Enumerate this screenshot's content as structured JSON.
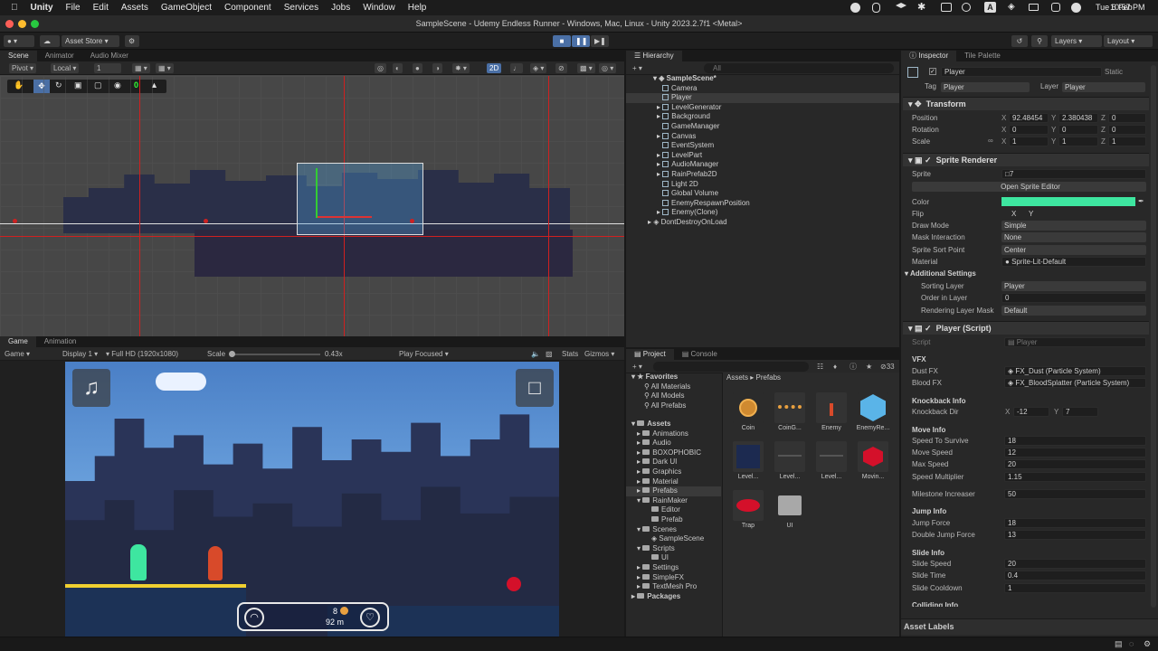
{
  "menubar": {
    "apple": "",
    "app": "Unity",
    "items": [
      "File",
      "Edit",
      "Assets",
      "GameObject",
      "Component",
      "Services",
      "Jobs",
      "Window",
      "Help"
    ],
    "date": "Tue 6 Feb",
    "time": "10:57 PM",
    "input": "A"
  },
  "window_title": "SampleScene - Udemy Endless Runner - Windows, Mac, Linux - Unity 2023.2.7f1 <Metal>",
  "toolbar": {
    "asset_store": "Asset Store",
    "layers": "Layers",
    "layout": "Layout"
  },
  "scene": {
    "tabs": [
      "Scene",
      "Animator",
      "Audio Mixer"
    ],
    "pivot": "Pivot",
    "local": "Local",
    "grid_value": "1",
    "mode_2d": "2D",
    "snap_count": "0"
  },
  "game": {
    "tabs": [
      "Game",
      "Animation"
    ],
    "view": "Game",
    "display": "Display 1",
    "resolution": "Full HD (1920x1080)",
    "scale_label": "Scale",
    "scale_value": "0.43x",
    "play_focused": "Play Focused",
    "stats": "Stats",
    "gizmos": "Gizmos",
    "coins": "8",
    "distance": "92  m"
  },
  "hierarchy": {
    "title": "Hierarchy",
    "search": "All",
    "scene": "SampleScene*",
    "items": [
      "Camera",
      "Player",
      "LevelGenerator",
      "Background",
      "GameManager",
      "Canvas",
      "EventSystem",
      "LevelPart",
      "AudioManager",
      "RainPrefab2D",
      "Light 2D",
      "Global Volume",
      "EnemyRespawnPosition",
      "Enemy(Clone)"
    ],
    "dont_destroy": "DontDestroyOnLoad"
  },
  "project": {
    "tabs": [
      "Project",
      "Console"
    ],
    "count": "33",
    "breadcrumb": [
      "Assets",
      "Prefabs"
    ],
    "favorites": "Favorites",
    "fav_items": [
      "All Materials",
      "All Models",
      "All Prefabs"
    ],
    "assets_root": "Assets",
    "tree": [
      {
        "label": "Animations",
        "depth": 1
      },
      {
        "label": "Audio",
        "depth": 1
      },
      {
        "label": "BOXOPHOBIC",
        "depth": 1
      },
      {
        "label": "Dark UI",
        "depth": 1
      },
      {
        "label": "Graphics",
        "depth": 1
      },
      {
        "label": "Material",
        "depth": 1
      },
      {
        "label": "Prefabs",
        "depth": 1
      },
      {
        "label": "RainMaker",
        "depth": 1
      },
      {
        "label": "Editor",
        "depth": 2
      },
      {
        "label": "Prefab",
        "depth": 2
      },
      {
        "label": "Scenes",
        "depth": 1
      },
      {
        "label": "SampleScene",
        "depth": 2
      },
      {
        "label": "Scripts",
        "depth": 1
      },
      {
        "label": "UI",
        "depth": 2
      },
      {
        "label": "Settings",
        "depth": 1
      },
      {
        "label": "SimpleFX",
        "depth": 1
      },
      {
        "label": "TextMesh Pro",
        "depth": 1
      }
    ],
    "packages": "Packages",
    "assets": [
      "Coin",
      "CoinG...",
      "Enemy",
      "EnemyRe...",
      "Level...",
      "Level...",
      "Level...",
      "Movin...",
      "Trap",
      "UI"
    ]
  },
  "inspector": {
    "tabs": [
      "Inspector",
      "Tile Palette"
    ],
    "object_name": "Player",
    "static": "Static",
    "tag_label": "Tag",
    "tag": "Player",
    "layer_label": "Layer",
    "layer": "Player",
    "transform": {
      "title": "Transform",
      "position": [
        "92.48454",
        "2.380438",
        "0"
      ],
      "rotation": [
        "0",
        "0",
        "0"
      ],
      "scale": [
        "1",
        "1",
        "1"
      ],
      "labels": [
        "Position",
        "Rotation",
        "Scale"
      ]
    },
    "sprite_renderer": {
      "title": "Sprite Renderer",
      "sprite_label": "Sprite",
      "sprite": "7",
      "open_editor": "Open Sprite Editor",
      "color_label": "Color",
      "color": "#3ee6a0",
      "flip_label": "Flip",
      "draw_mode_label": "Draw Mode",
      "draw_mode": "Simple",
      "mask_label": "Mask Interaction",
      "mask": "None",
      "sort_point_label": "Sprite Sort Point",
      "sort_point": "Center",
      "material_label": "Material",
      "material": "Sprite-Lit-Default",
      "additional": "Additional Settings",
      "sorting_layer_label": "Sorting Layer",
      "sorting_layer": "Player",
      "order_label": "Order in Layer",
      "order": "0",
      "rendering_mask_label": "Rendering Layer Mask",
      "rendering_mask": "Default"
    },
    "player_script": {
      "title": "Player (Script)",
      "script_label": "Script",
      "script": "Player",
      "vfx": "VFX",
      "dust_label": "Dust FX",
      "dust": "FX_Dust (Particle System)",
      "blood_label": "Blood FX",
      "blood": "FX_BloodSplatter (Particle System)",
      "knockback": "Knockback Info",
      "knockback_dir_label": "Knockback Dir",
      "knockback_x": "-12",
      "knockback_y": "7",
      "move": "Move Info",
      "speed_survive_label": "Speed To Survive",
      "speed_survive": "18",
      "move_speed_label": "Move Speed",
      "move_speed": "12",
      "max_speed_label": "Max Speed",
      "max_speed": "20",
      "speed_mult_label": "Speed Multiplier",
      "speed_mult": "1.15",
      "milestone_label": "Milestone Increaser",
      "milestone": "50",
      "jump": "Jump Info",
      "jump_force_label": "Jump Force",
      "jump_force": "18",
      "double_jump_label": "Double Jump Force",
      "double_jump": "13",
      "slide": "Slide Info",
      "slide_speed_label": "Slide Speed",
      "slide_speed": "20",
      "slide_time_label": "Slide Time",
      "slide_time": "0.4",
      "slide_cd_label": "Slide Cooldown",
      "slide_cd": "1",
      "colliding": "Colliding Info"
    },
    "asset_labels": "Asset Labels"
  }
}
